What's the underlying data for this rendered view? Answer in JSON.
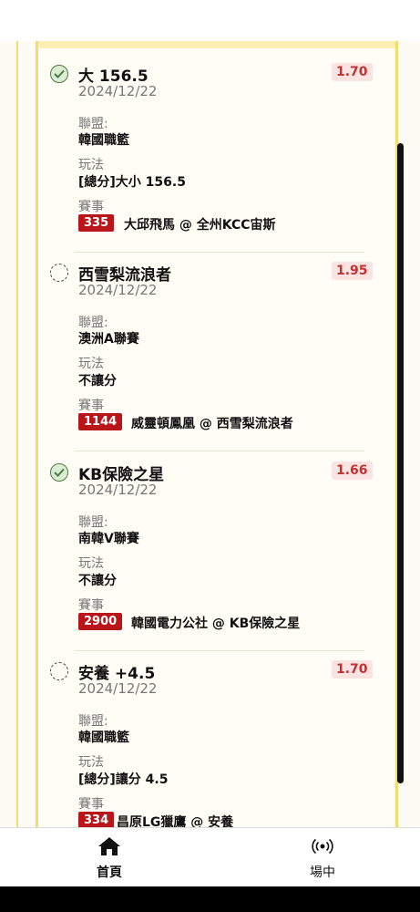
{
  "colors": {
    "accent_border": "#f2dc6f",
    "odds_bg": "#fbe3e1",
    "odds_text": "#c43131",
    "event_badge": "#b8161b",
    "won_green": "#4a7d3e"
  },
  "labels": {
    "league": "聯盟:",
    "play": "玩法",
    "event": "賽事"
  },
  "bets": [
    {
      "status": "won",
      "status_icon": "check-circle-icon",
      "title": "大 156.5",
      "date": "2024/12/22",
      "odds": "1.70",
      "league": "韓國職籃",
      "play": "[總分]大小 156.5",
      "event_id": "335",
      "event_name": "大邱飛馬 @ 全州KCC宙斯"
    },
    {
      "status": "pending",
      "status_icon": "pending-circle-icon",
      "title": "西雪梨流浪者",
      "date": "2024/12/22",
      "odds": "1.95",
      "league": "澳洲A聯賽",
      "play": "不讓分",
      "event_id": "1144",
      "event_name": "威靈頓鳳凰 @ 西雪梨流浪者"
    },
    {
      "status": "won",
      "status_icon": "check-circle-icon",
      "title": "KB保險之星",
      "date": "2024/12/22",
      "odds": "1.66",
      "league": "南韓V聯賽",
      "play": "不讓分",
      "event_id": "2900",
      "event_name": "韓國電力公社 @ KB保險之星"
    },
    {
      "status": "pending",
      "status_icon": "pending-circle-icon",
      "title": "安養 +4.5",
      "date": "2024/12/22",
      "odds": "1.70",
      "league": "韓國職籃",
      "play": "[總分]讓分 4.5",
      "event_id": "334",
      "event_name": "昌原LG獵鷹 @ 安養"
    }
  ],
  "nav": [
    {
      "label": "首頁",
      "icon": "home-icon",
      "active": true
    },
    {
      "label": "場中",
      "icon": "live-broadcast-icon",
      "active": false
    }
  ]
}
